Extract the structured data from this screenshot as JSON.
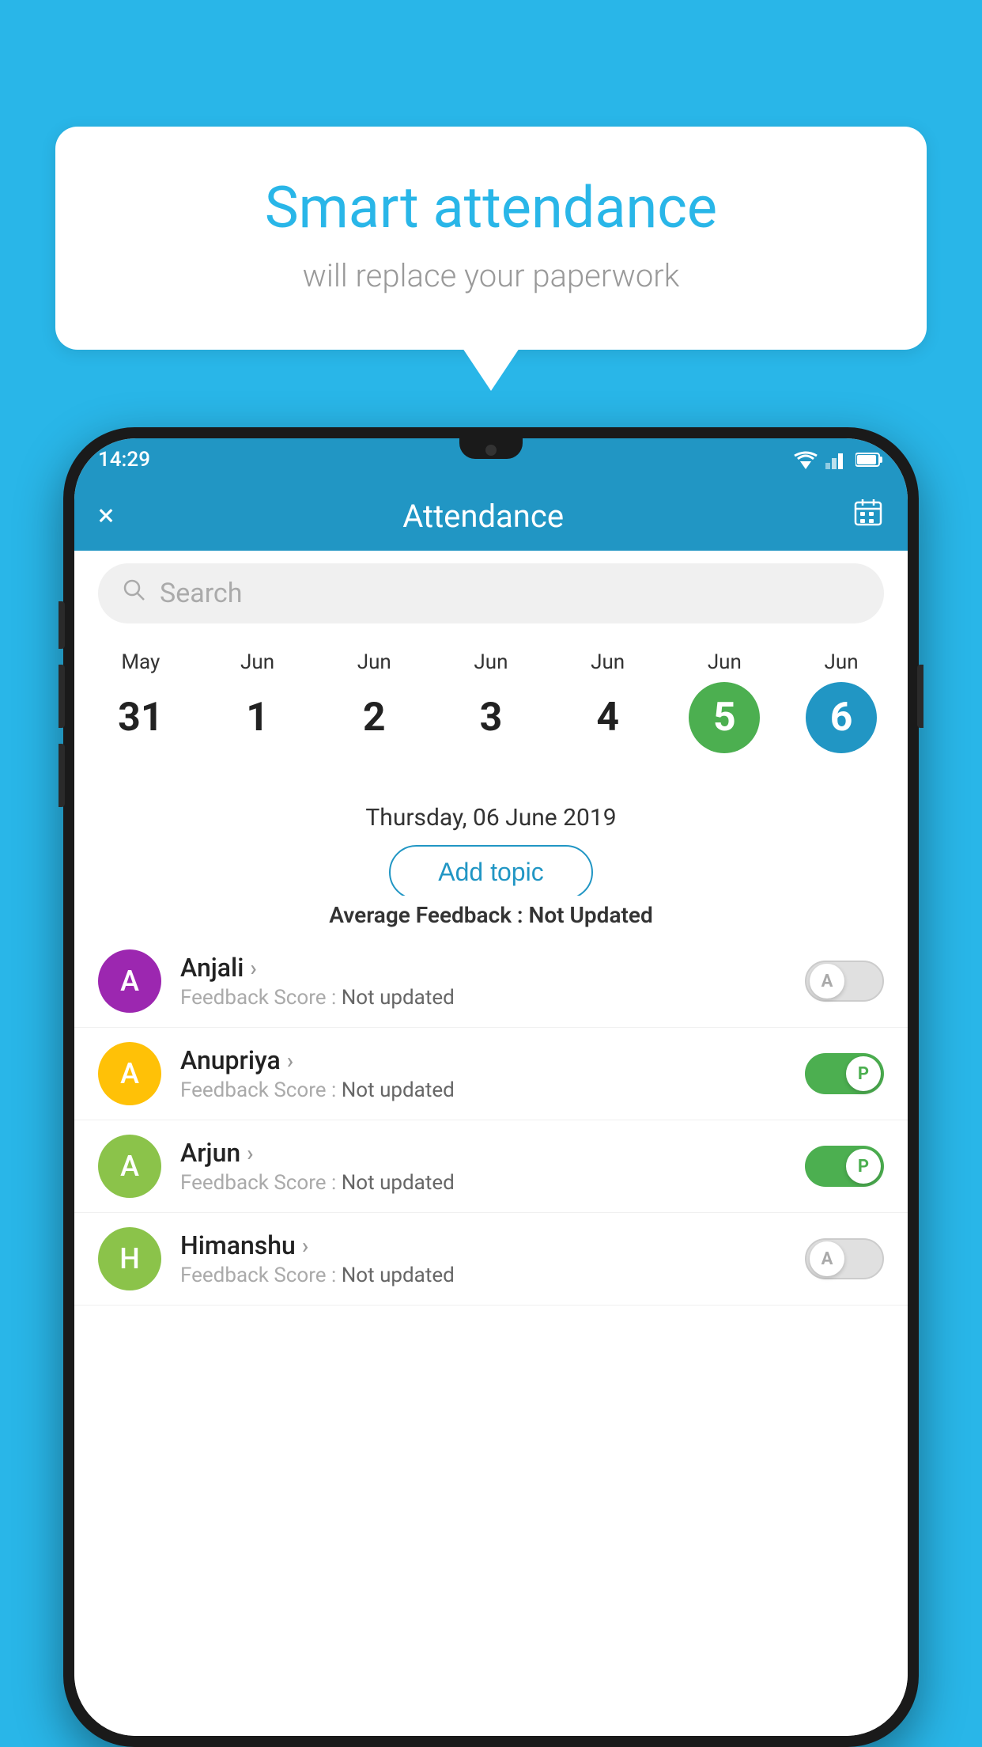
{
  "page": {
    "background_color": "#29b6e8"
  },
  "speech_bubble": {
    "title": "Smart attendance",
    "subtitle": "will replace your paperwork"
  },
  "status_bar": {
    "time": "14:29"
  },
  "app_bar": {
    "title": "Attendance",
    "close_label": "×",
    "calendar_icon": "calendar"
  },
  "search": {
    "placeholder": "Search"
  },
  "calendar": {
    "days": [
      {
        "month": "May",
        "date": "31",
        "state": "normal"
      },
      {
        "month": "Jun",
        "date": "1",
        "state": "normal"
      },
      {
        "month": "Jun",
        "date": "2",
        "state": "normal"
      },
      {
        "month": "Jun",
        "date": "3",
        "state": "normal"
      },
      {
        "month": "Jun",
        "date": "4",
        "state": "normal"
      },
      {
        "month": "Jun",
        "date": "5",
        "state": "today"
      },
      {
        "month": "Jun",
        "date": "6",
        "state": "selected"
      }
    ]
  },
  "selected_date": "Thursday, 06 June 2019",
  "add_topic_label": "Add topic",
  "average_feedback_label": "Average Feedback :",
  "average_feedback_value": "Not Updated",
  "students": [
    {
      "name": "Anjali",
      "avatar_letter": "A",
      "avatar_color": "#9c27b0",
      "feedback_label": "Feedback Score :",
      "feedback_value": "Not updated",
      "toggle_state": "off",
      "toggle_letter": "A"
    },
    {
      "name": "Anupriya",
      "avatar_letter": "A",
      "avatar_color": "#ffc107",
      "feedback_label": "Feedback Score :",
      "feedback_value": "Not updated",
      "toggle_state": "on",
      "toggle_letter": "P"
    },
    {
      "name": "Arjun",
      "avatar_letter": "A",
      "avatar_color": "#8bc34a",
      "feedback_label": "Feedback Score :",
      "feedback_value": "Not updated",
      "toggle_state": "on",
      "toggle_letter": "P"
    },
    {
      "name": "Himanshu",
      "avatar_letter": "H",
      "avatar_color": "#8bc34a",
      "feedback_label": "Feedback Score :",
      "feedback_value": "Not updated",
      "toggle_state": "off",
      "toggle_letter": "A"
    }
  ]
}
